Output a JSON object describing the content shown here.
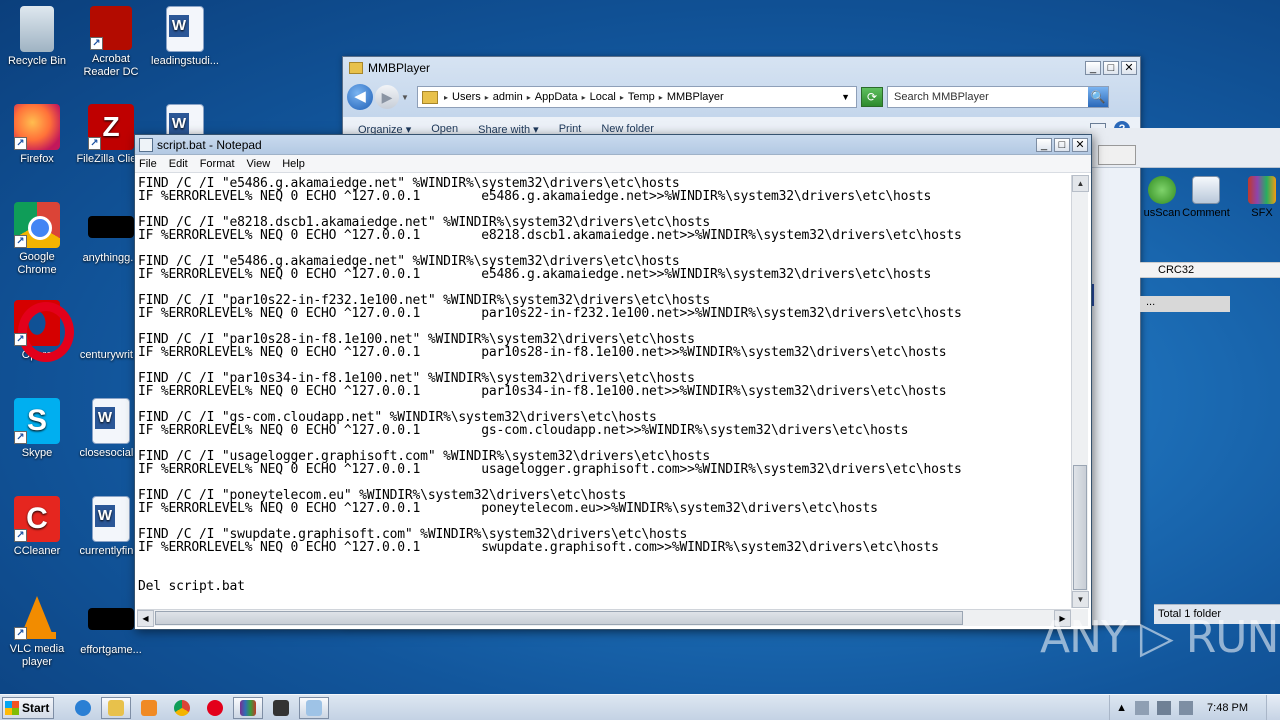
{
  "desktop": {
    "icons": [
      {
        "label": "Recycle Bin",
        "glyph": "",
        "shortcut": ""
      },
      {
        "label": "Acrobat Reader DC",
        "glyph": "",
        "shortcut": "↗"
      },
      {
        "label": "leadingstudi...",
        "glyph": "",
        "shortcut": ""
      },
      {
        "label": "Firefox",
        "glyph": "",
        "shortcut": "↗"
      },
      {
        "label": "FileZilla Clie...",
        "glyph": "Z",
        "shortcut": "↗"
      },
      {
        "label": "Google Chrome",
        "glyph": "",
        "shortcut": "↗"
      },
      {
        "label": "anythingg...",
        "glyph": "",
        "shortcut": ""
      },
      {
        "label": "Opera",
        "glyph": "",
        "shortcut": "↗"
      },
      {
        "label": "centurywrit...",
        "glyph": "",
        "shortcut": ""
      },
      {
        "label": "Skype",
        "glyph": "S",
        "shortcut": "↗"
      },
      {
        "label": "closesocial...",
        "glyph": "",
        "shortcut": ""
      },
      {
        "label": "CCleaner",
        "glyph": "C",
        "shortcut": "↗"
      },
      {
        "label": "currentlyfin...",
        "glyph": "",
        "shortcut": ""
      },
      {
        "label": "VLC media player",
        "glyph": "",
        "shortcut": "↗"
      },
      {
        "label": "effortgame...",
        "glyph": "",
        "shortcut": ""
      }
    ]
  },
  "explorer": {
    "title": "MMBPlayer",
    "window_buttons": {
      "minimize": "_",
      "maximize": "□",
      "close": "✕"
    },
    "back_glyph": "◀",
    "forward_glyph": "▶",
    "dropdown_glyph": "▼",
    "breadcrumb": [
      "Users",
      "admin",
      "AppData",
      "Local",
      "Temp",
      "MMBPlayer"
    ],
    "breadcrumb_sep": "▸",
    "refresh_glyph": "⟳",
    "search_placeholder": "Search MMBPlayer",
    "search_glyph": "🔍",
    "toolbar": [
      "Organize ▾",
      "Open",
      "Share with ▾",
      "Print",
      "New folder"
    ],
    "help_glyph": "?",
    "status": "Total 1 folder"
  },
  "side_app": {
    "tools": [
      "usScan",
      "Comment",
      "SFX"
    ],
    "column_header": "CRC32",
    "row_text": "..."
  },
  "notepad": {
    "title": "script.bat - Notepad",
    "window_buttons": {
      "minimize": "_",
      "maximize": "□",
      "close": "✕"
    },
    "menu": [
      "File",
      "Edit",
      "Format",
      "View",
      "Help"
    ],
    "scroll_up": "▲",
    "scroll_down": "▼",
    "scroll_left": "◀",
    "scroll_right": "▶",
    "content": "FIND /C /I \"e5486.g.akamaiedge.net\" %WINDIR%\\system32\\drivers\\etc\\hosts\nIF %ERRORLEVEL% NEQ 0 ECHO ^127.0.0.1        e5486.g.akamaiedge.net>>%WINDIR%\\system32\\drivers\\etc\\hosts\n\nFIND /C /I \"e8218.dscb1.akamaiedge.net\" %WINDIR%\\system32\\drivers\\etc\\hosts\nIF %ERRORLEVEL% NEQ 0 ECHO ^127.0.0.1        e8218.dscb1.akamaiedge.net>>%WINDIR%\\system32\\drivers\\etc\\hosts\n\nFIND /C /I \"e5486.g.akamaiedge.net\" %WINDIR%\\system32\\drivers\\etc\\hosts\nIF %ERRORLEVEL% NEQ 0 ECHO ^127.0.0.1        e5486.g.akamaiedge.net>>%WINDIR%\\system32\\drivers\\etc\\hosts\n\nFIND /C /I \"par10s22-in-f232.1e100.net\" %WINDIR%\\system32\\drivers\\etc\\hosts\nIF %ERRORLEVEL% NEQ 0 ECHO ^127.0.0.1        par10s22-in-f232.1e100.net>>%WINDIR%\\system32\\drivers\\etc\\hosts\n\nFIND /C /I \"par10s28-in-f8.1e100.net\" %WINDIR%\\system32\\drivers\\etc\\hosts\nIF %ERRORLEVEL% NEQ 0 ECHO ^127.0.0.1        par10s28-in-f8.1e100.net>>%WINDIR%\\system32\\drivers\\etc\\hosts\n\nFIND /C /I \"par10s34-in-f8.1e100.net\" %WINDIR%\\system32\\drivers\\etc\\hosts\nIF %ERRORLEVEL% NEQ 0 ECHO ^127.0.0.1        par10s34-in-f8.1e100.net>>%WINDIR%\\system32\\drivers\\etc\\hosts\n\nFIND /C /I \"gs-com.cloudapp.net\" %WINDIR%\\system32\\drivers\\etc\\hosts\nIF %ERRORLEVEL% NEQ 0 ECHO ^127.0.0.1        gs-com.cloudapp.net>>%WINDIR%\\system32\\drivers\\etc\\hosts\n\nFIND /C /I \"usagelogger.graphisoft.com\" %WINDIR%\\system32\\drivers\\etc\\hosts\nIF %ERRORLEVEL% NEQ 0 ECHO ^127.0.0.1        usagelogger.graphisoft.com>>%WINDIR%\\system32\\drivers\\etc\\hosts\n\nFIND /C /I \"poneytelecom.eu\" %WINDIR%\\system32\\drivers\\etc\\hosts\nIF %ERRORLEVEL% NEQ 0 ECHO ^127.0.0.1        poneytelecom.eu>>%WINDIR%\\system32\\drivers\\etc\\hosts\n\nFIND /C /I \"swupdate.graphisoft.com\" %WINDIR%\\system32\\drivers\\etc\\hosts\nIF %ERRORLEVEL% NEQ 0 ECHO ^127.0.0.1        swupdate.graphisoft.com>>%WINDIR%\\system32\\drivers\\etc\\hosts\n\n\nDel script.bat"
  },
  "watermark": "ANY ▷ RUN",
  "taskbar": {
    "start_label": "Start",
    "clock": "7:48 PM",
    "tray_expand": "▲",
    "colors": {
      "ie": "#2a7fd4",
      "explorer": "#e8c14b",
      "media": "#f08a24",
      "chrome": "#34a853",
      "opera": "#e3001b",
      "winrar": "#7a2f8f",
      "floppy": "#333333",
      "notepad": "#9ec3e6"
    }
  }
}
